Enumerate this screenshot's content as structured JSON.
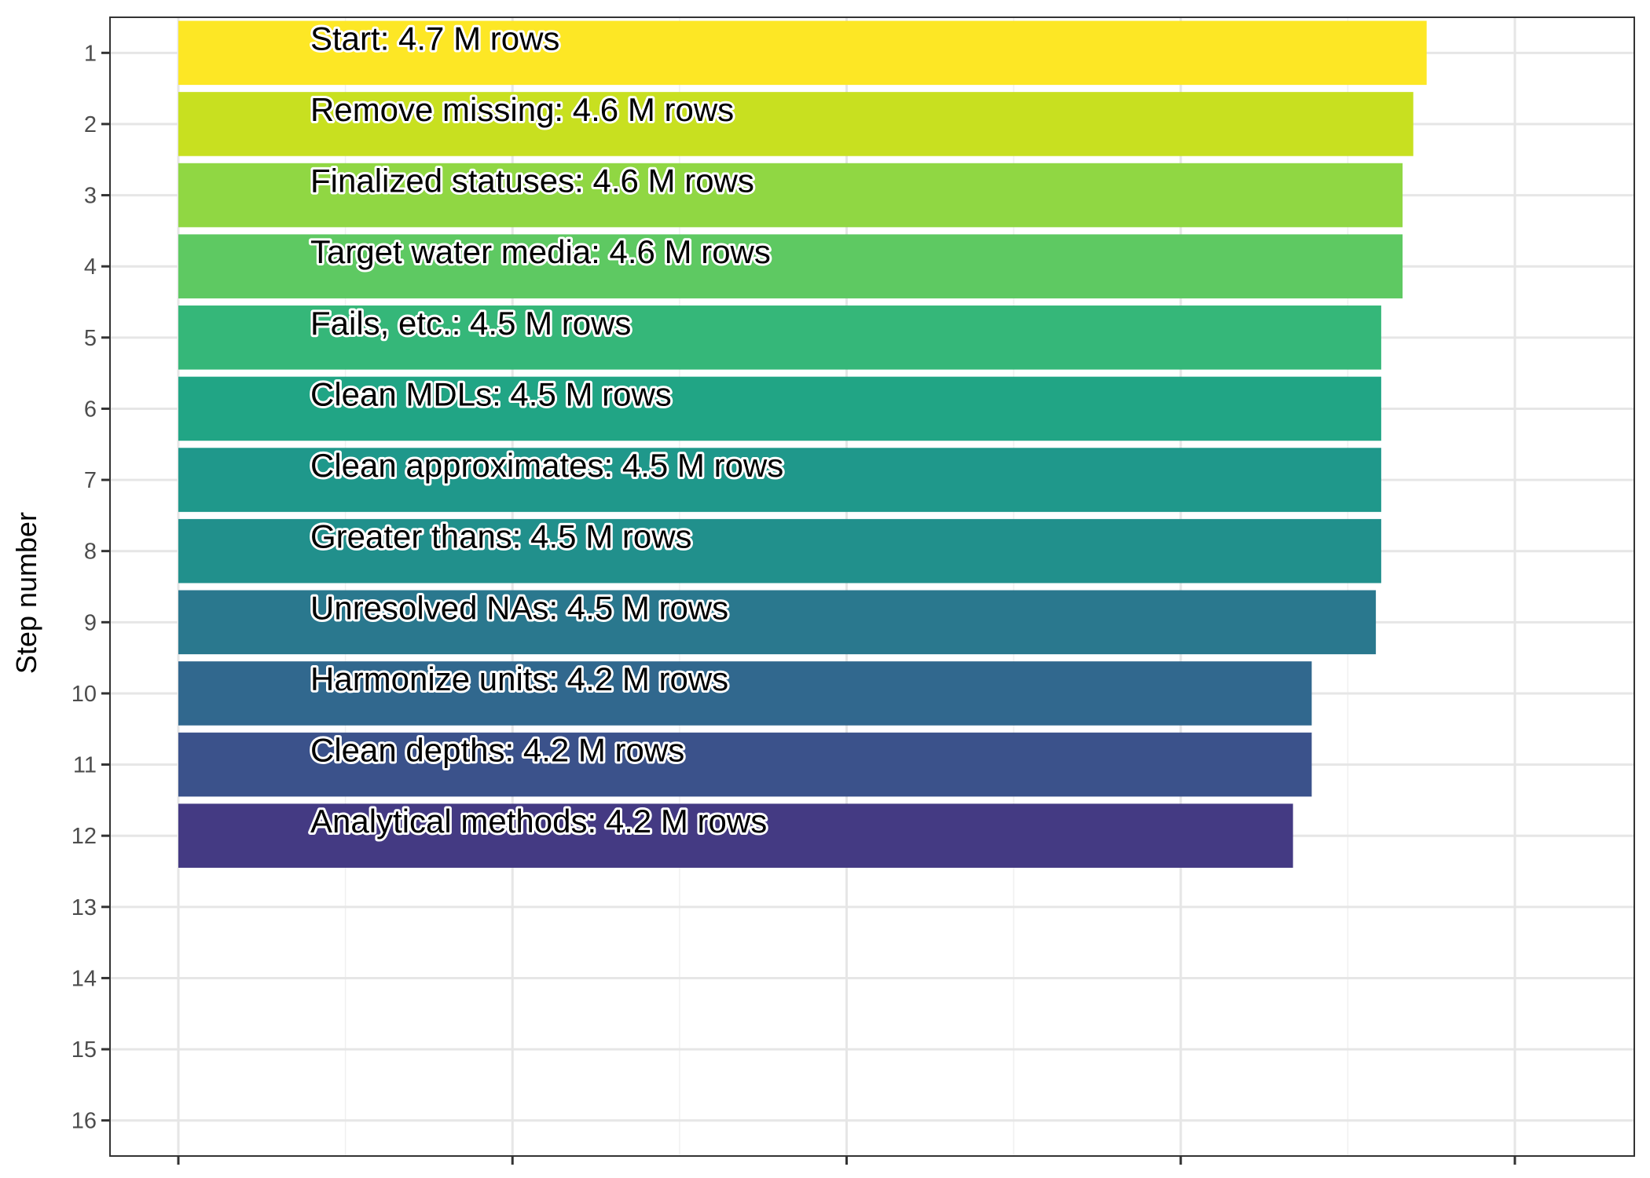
{
  "chart_data": {
    "type": "bar",
    "orientation": "horizontal",
    "title": "",
    "xlabel": "",
    "ylabel": "Step number",
    "y_ticks": [
      "1",
      "2",
      "3",
      "4",
      "5",
      "6",
      "7",
      "8",
      "9",
      "10",
      "11",
      "12",
      "13",
      "14",
      "15",
      "16"
    ],
    "ylim": [
      0.5,
      16.5
    ],
    "xlim": [
      0,
      5
    ],
    "x_tick_count": 5,
    "grid": true,
    "legend": "none",
    "row_unit": "M rows",
    "categories": [
      "1",
      "2",
      "3",
      "4",
      "5",
      "6",
      "7",
      "8",
      "9",
      "10",
      "11",
      "12"
    ],
    "series": [
      {
        "values": [
          4.67,
          4.62,
          4.58,
          4.58,
          4.5,
          4.5,
          4.5,
          4.5,
          4.48,
          4.24,
          4.24,
          4.17
        ],
        "labels": [
          "Start:  4.7 M rows",
          "Remove missing:  4.6 M rows",
          "Finalized statuses:  4.6 M rows",
          "Target water media:  4.6 M rows",
          "Fails, etc.:  4.5 M rows",
          "Clean MDLs:  4.5 M rows",
          "Clean approximates:  4.5 M rows",
          "Greater thans:  4.5 M rows",
          "Unresolved NAs:  4.5 M rows",
          "Harmonize units:  4.2 M rows",
          "Clean depths:  4.2 M rows",
          "Analytical methods:  4.2 M rows"
        ],
        "colors": [
          "#FDE725",
          "#C8E020",
          "#90D743",
          "#5EC962",
          "#35B779",
          "#21A585",
          "#1F988B",
          "#21908C",
          "#2A788E",
          "#31688E",
          "#3B528B",
          "#443A83"
        ]
      }
    ]
  }
}
